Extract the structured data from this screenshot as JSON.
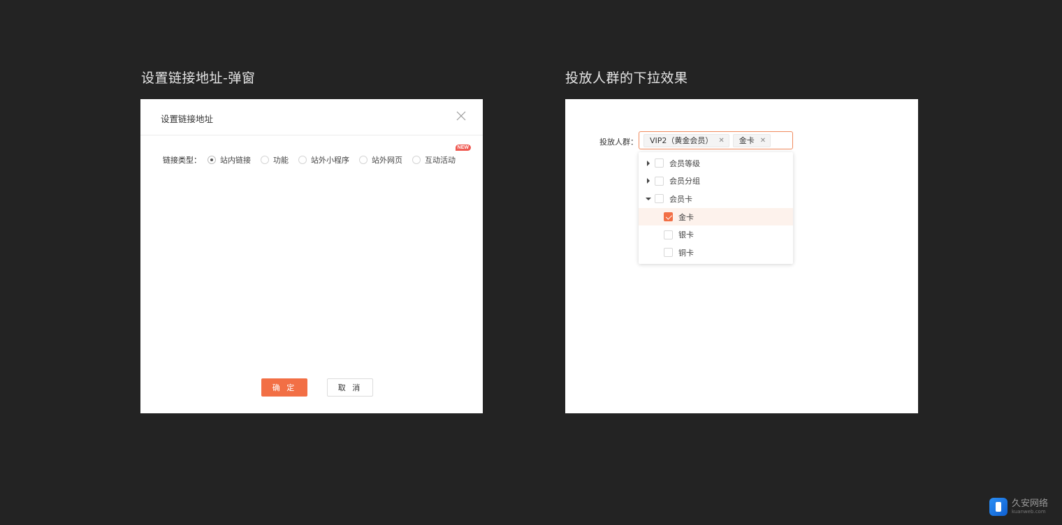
{
  "left_section": {
    "title": "设置链接地址-弹窗",
    "modal": {
      "title": "设置链接地址",
      "link_type_label": "链接类型：",
      "options": [
        {
          "label": "站内链接",
          "checked": true
        },
        {
          "label": "功能",
          "checked": false
        },
        {
          "label": "站外小程序",
          "checked": false
        },
        {
          "label": "站外网页",
          "checked": false
        },
        {
          "label": "互动活动",
          "checked": false,
          "badge": "NEW"
        }
      ],
      "confirm_label": "确 定",
      "cancel_label": "取 消"
    }
  },
  "right_section": {
    "title": "投放人群的下拉效果",
    "audience_label": "投放人群：",
    "selected_tags": [
      "VIP2（黄金会员）",
      "金卡"
    ],
    "tree": [
      {
        "label": "会员等级",
        "expanded": false,
        "checked": false
      },
      {
        "label": "会员分组",
        "expanded": false,
        "checked": false
      },
      {
        "label": "会员卡",
        "expanded": true,
        "checked": false,
        "children": [
          {
            "label": "金卡",
            "checked": true
          },
          {
            "label": "银卡",
            "checked": false
          },
          {
            "label": "铜卡",
            "checked": false
          }
        ]
      }
    ]
  },
  "colors": {
    "background": "#232323",
    "accent": "#f26f45",
    "badge": "#ef5a52",
    "selected_row": "#fdf2ec"
  },
  "watermark": {
    "name": "久安网络",
    "url": "kuanweb.com"
  }
}
